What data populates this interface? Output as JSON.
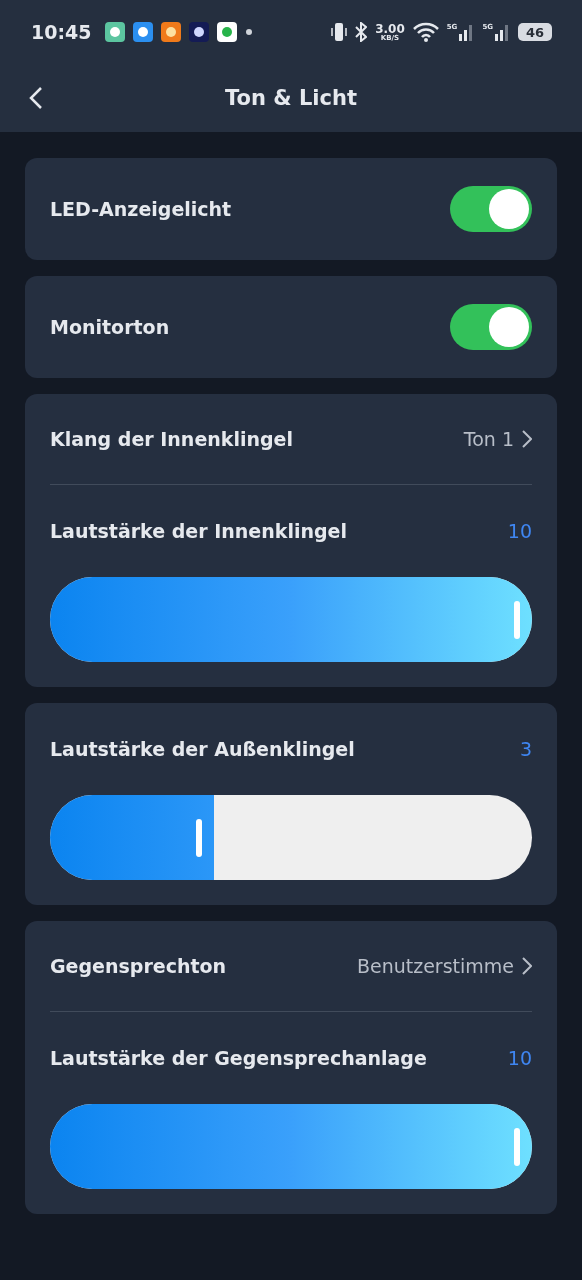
{
  "status_bar": {
    "time": "10:45",
    "speed_value": "3.00",
    "speed_unit": "KB/S",
    "network_1": "5G",
    "network_2": "5G",
    "battery": "46"
  },
  "header": {
    "title": "Ton & Licht"
  },
  "cards": [
    {
      "rows": [
        {
          "kind": "toggle",
          "label": "LED-Anzeigelicht",
          "on": true
        }
      ]
    },
    {
      "rows": [
        {
          "kind": "toggle",
          "label": "Monitorton",
          "on": true
        }
      ]
    },
    {
      "rows": [
        {
          "kind": "select",
          "label": "Klang der Innenklingel",
          "value": "Ton 1"
        },
        {
          "kind": "slider",
          "label": "Lautstärke der Innenklingel",
          "reading": "10",
          "level": 1
        }
      ]
    },
    {
      "rows": [
        {
          "kind": "slider",
          "label": "Lautstärke der Außenklingel",
          "reading": "3",
          "level": 0.34
        }
      ]
    },
    {
      "rows": [
        {
          "kind": "select",
          "label": "Gegensprechton",
          "value": "Benutzerstimme"
        },
        {
          "kind": "slider",
          "label": "Lautstärke der Gegensprechanlage",
          "reading": "10",
          "level": 1
        }
      ]
    }
  ]
}
